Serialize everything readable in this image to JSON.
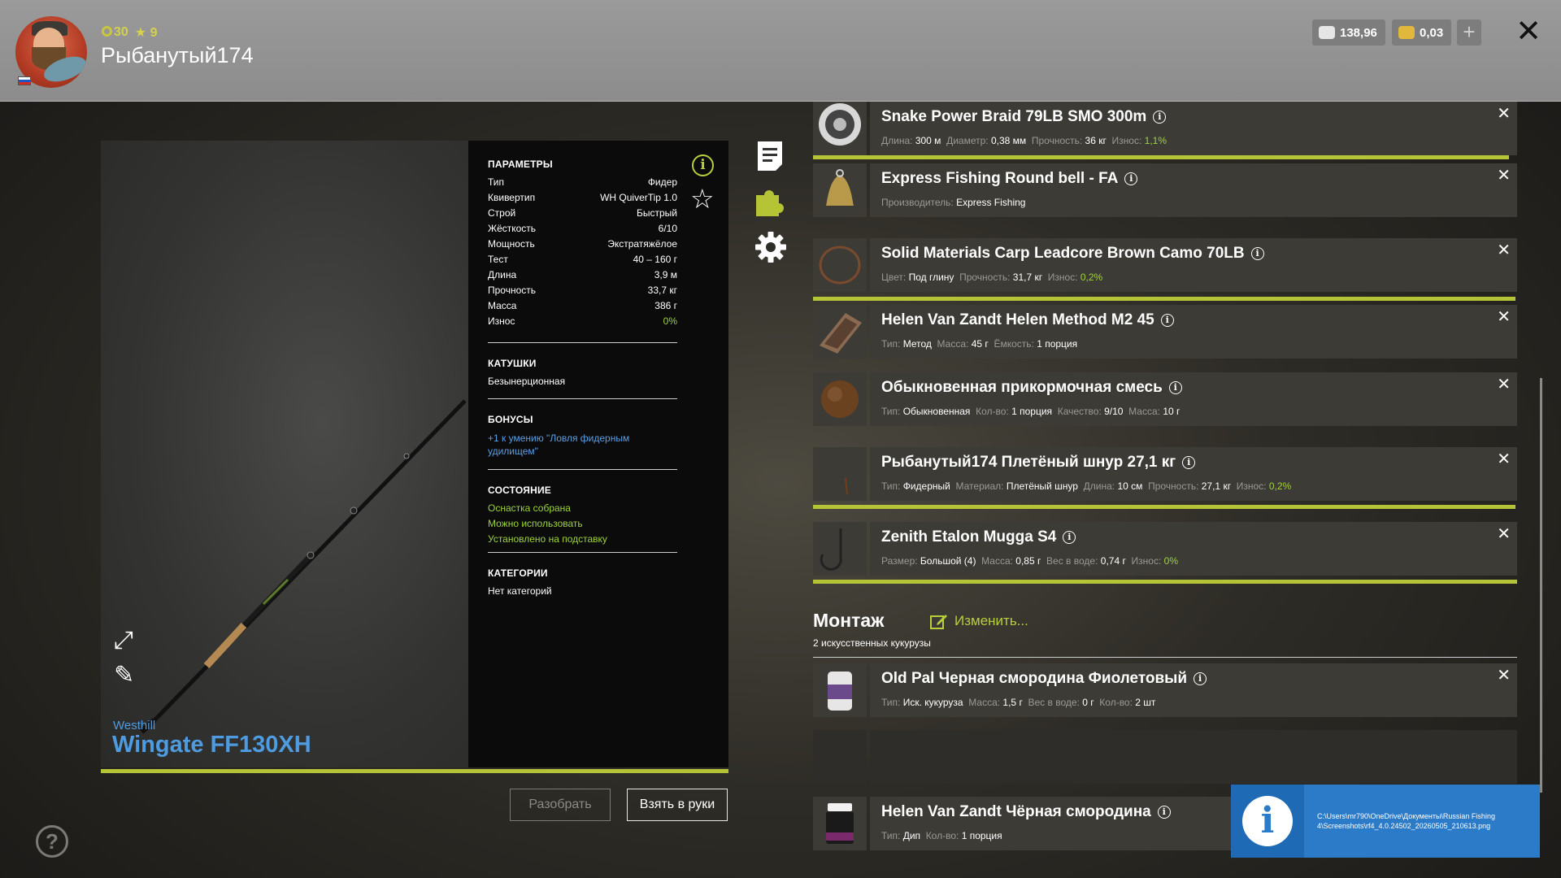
{
  "player": {
    "level": "30",
    "rank": "9",
    "name": "Рыбанутый174"
  },
  "wallet": {
    "silver": "138,96",
    "gold": "0,03",
    "add_label": "+"
  },
  "close_label": "✕",
  "rod": {
    "brand": "Westhill",
    "name": "Wingate FF130XH",
    "params_title": "ПАРАМЕТРЫ",
    "params": [
      {
        "label": "Тип",
        "value": "Фидер"
      },
      {
        "label": "Квивертип",
        "value": "WH QuiverTip 1.0"
      },
      {
        "label": "Строй",
        "value": "Быстрый"
      },
      {
        "label": "Жёсткость",
        "value": "6/10"
      },
      {
        "label": "Мощность",
        "value": "Экстратяжёлое"
      },
      {
        "label": "Тест",
        "value": "40 – 160 г"
      },
      {
        "label": "Длина",
        "value": "3,9 м"
      },
      {
        "label": "Прочность",
        "value": "33,7 кг"
      },
      {
        "label": "Масса",
        "value": "386 г"
      },
      {
        "label": "Износ",
        "value": "0%"
      }
    ],
    "reels_title": "КАТУШКИ",
    "reels_value": "Безынерционная",
    "bonus_title": "БОНУСЫ",
    "bonus_value": "+1 к умению \"Ловля фидерным удилищем\"",
    "state_title": "СОСТОЯНИЕ",
    "state_items": [
      "Оснастка собрана",
      "Можно использовать",
      "Установлено на подставку"
    ],
    "categories_title": "КАТЕГОРИИ",
    "categories_value": "Нет категорий"
  },
  "buttons": {
    "disassemble": "Разобрать",
    "take": "Взять в руки"
  },
  "items": [
    {
      "title": "Snake Power Braid 79LB SMO 300m",
      "sub": [
        [
          "Длина:",
          "300 м"
        ],
        [
          "Диаметр:",
          "0,38 мм"
        ],
        [
          "Прочность:",
          "36 кг"
        ],
        [
          "Износ:",
          "1,1%"
        ]
      ]
    },
    {
      "title": "Express Fishing Round bell - FA",
      "sub": [
        [
          "Производитель:",
          "Express Fishing"
        ]
      ]
    },
    {
      "title": "Solid Materials Carp Leadcore Brown Camo 70LB",
      "sub": [
        [
          "Цвет:",
          "Под глину"
        ],
        [
          "Прочность:",
          "31,7 кг"
        ],
        [
          "Износ:",
          "0,2%"
        ]
      ]
    },
    {
      "title": "Helen Van Zandt Helen Method M2 45",
      "sub": [
        [
          "Тип:",
          "Метод"
        ],
        [
          "Масса:",
          "45 г"
        ],
        [
          "Ёмкость:",
          "1 порция"
        ]
      ]
    },
    {
      "title": "Обыкновенная прикормочная смесь",
      "sub": [
        [
          "Тип:",
          "Обыкновенная"
        ],
        [
          "Кол-во:",
          "1 порция"
        ],
        [
          "Качество:",
          "9/10"
        ],
        [
          "Масса:",
          "10 г"
        ]
      ]
    },
    {
      "title": "Рыбанутый174 Плетёный шнур 27,1 кг",
      "sub": [
        [
          "Тип:",
          "Фидерный"
        ],
        [
          "Материал:",
          "Плетёный шнур"
        ],
        [
          "Длина:",
          "10 см"
        ],
        [
          "Прочность:",
          "27,1 кг"
        ],
        [
          "Износ:",
          "0,2%"
        ]
      ]
    },
    {
      "title": "Zenith Etalon Mugga S4",
      "sub": [
        [
          "Размер:",
          "Большой (4)"
        ],
        [
          "Масса:",
          "0,85 г"
        ],
        [
          "Вес в воде:",
          "0,74 г"
        ],
        [
          "Износ:",
          "0%"
        ]
      ]
    },
    {
      "title": "Old Pal Черная смородина Фиолетовый",
      "sub": [
        [
          "Тип:",
          "Иск. кукуруза"
        ],
        [
          "Масса:",
          "1,5 г"
        ],
        [
          "Вес в воде:",
          "0 г"
        ],
        [
          "Кол-во:",
          "2 шт"
        ]
      ]
    },
    {
      "title": "Helen Van Zandt Чёрная смородина",
      "sub": [
        [
          "Тип:",
          "Дип"
        ],
        [
          "Кол-во:",
          "1 порция"
        ]
      ]
    }
  ],
  "montage": {
    "title": "Монтаж",
    "edit_label": "Изменить...",
    "subtitle": "2 искусственных кукурузы"
  },
  "toast": {
    "path": "C:\\Users\\mr790\\OneDrive\\Документы\\Russian Fishing 4\\Screenshots\\rf4_4.0.24502_20260505_210613.png"
  },
  "help_label": "?",
  "colors": {
    "accent": "#b5c436",
    "blue": "#4f9be0",
    "green_text": "#9fd33b"
  }
}
